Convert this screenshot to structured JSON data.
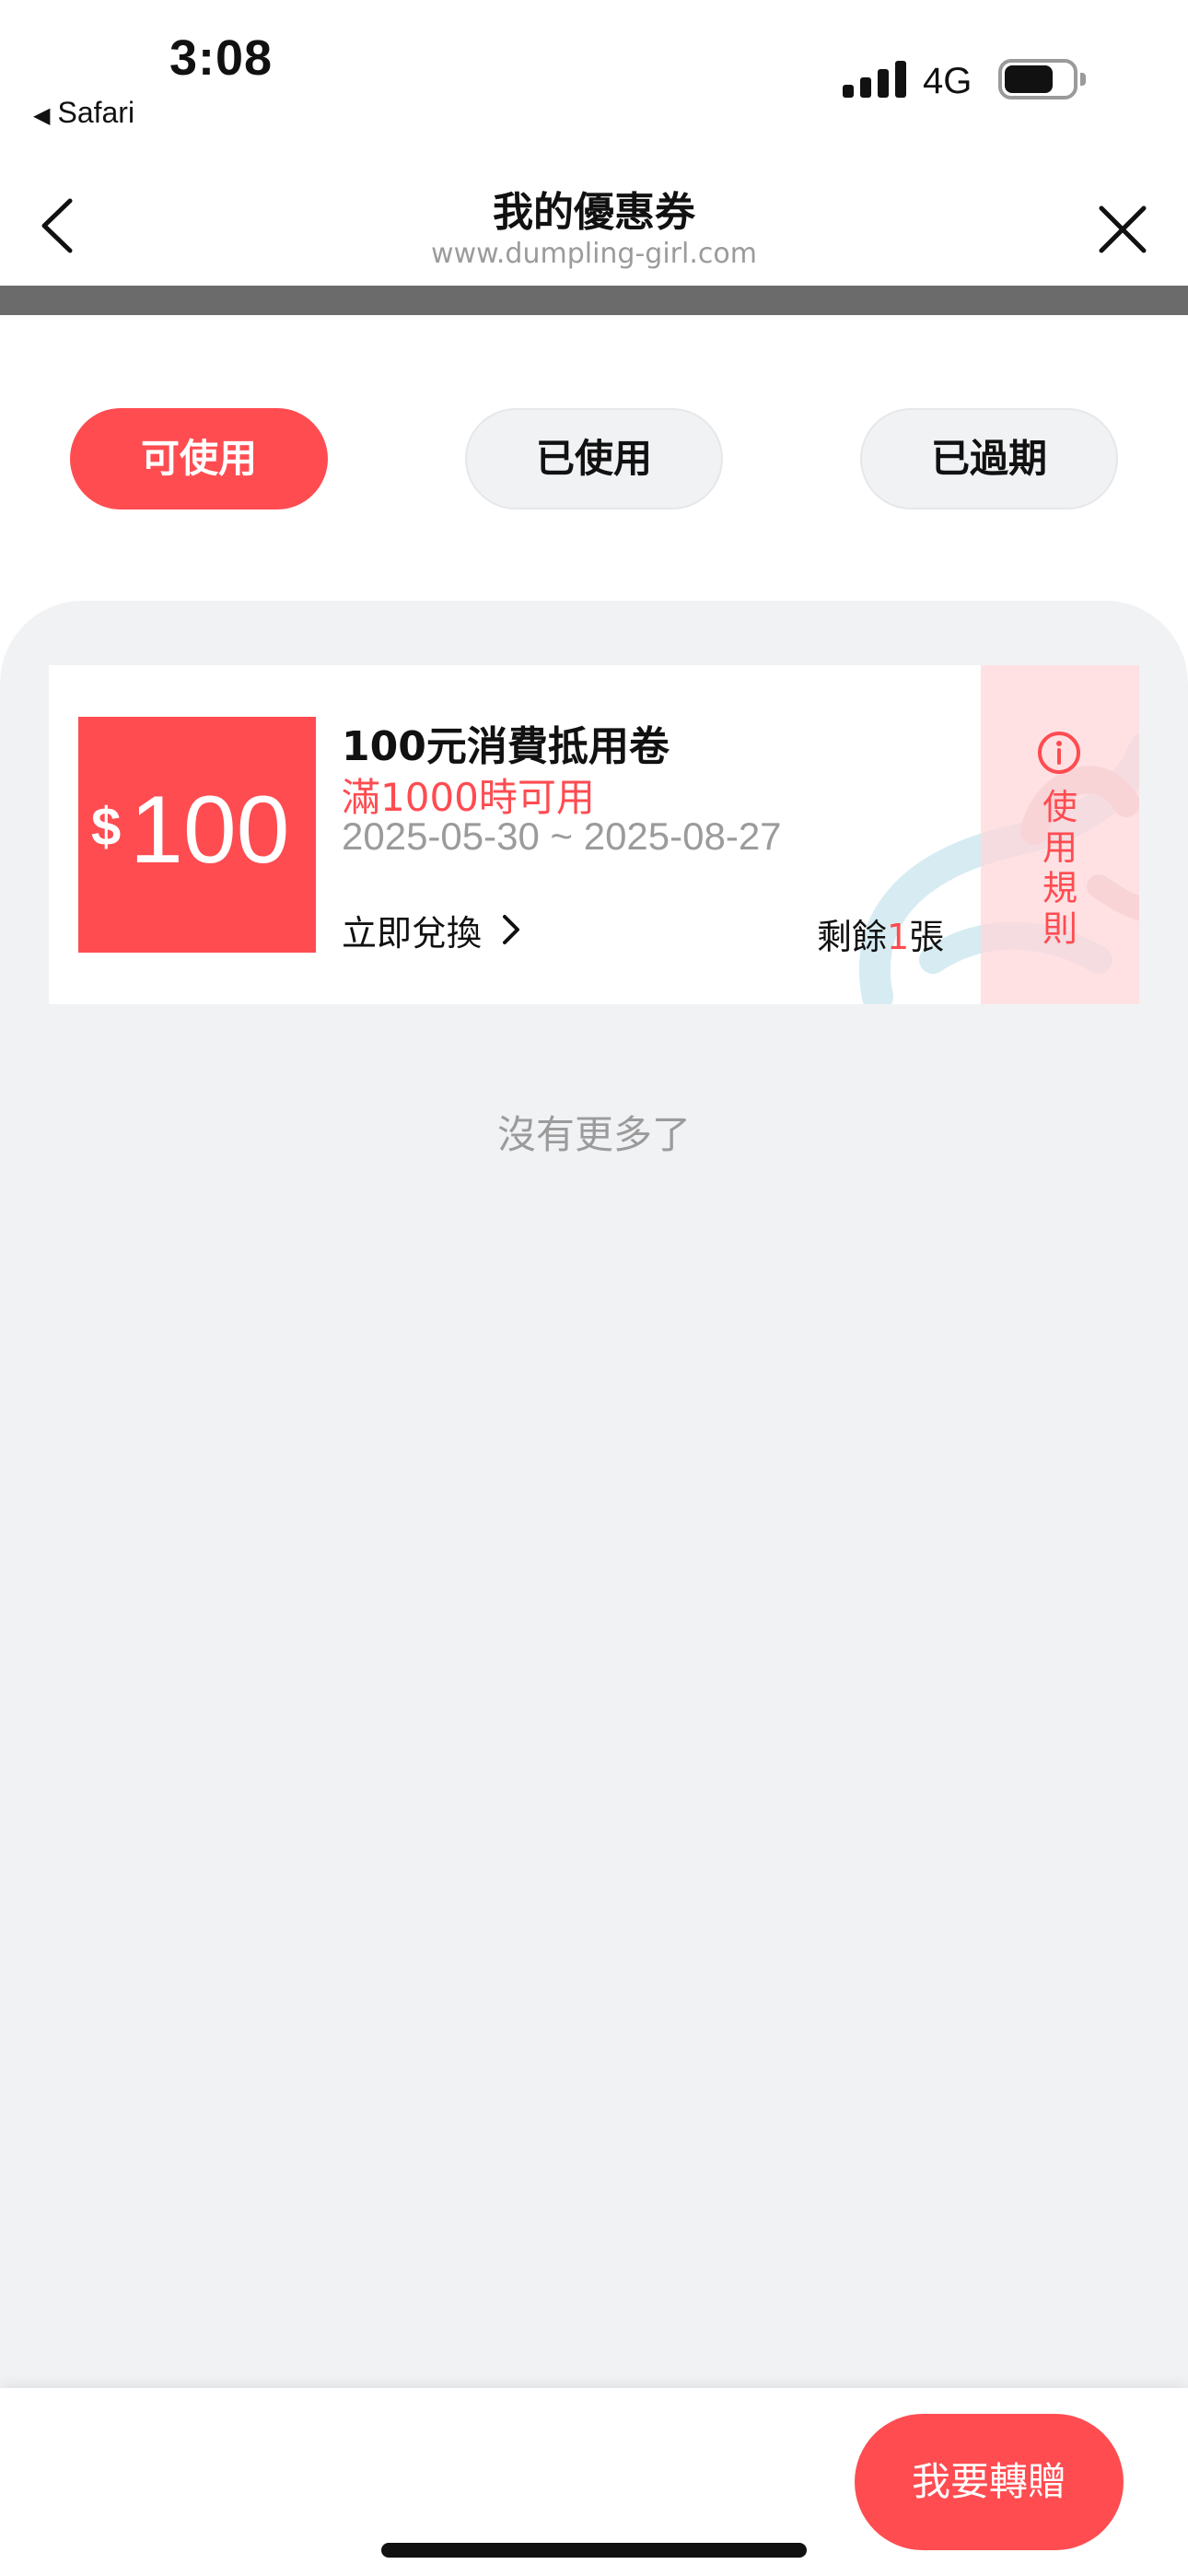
{
  "status_bar": {
    "time": "3:08",
    "back_app": "Safari",
    "network": "4G",
    "icons": [
      "signal-icon",
      "battery-icon"
    ]
  },
  "header": {
    "title": "我的優惠券",
    "url": "www.dumpling-girl.com",
    "icons": [
      "back-arrow-icon",
      "close-icon"
    ]
  },
  "tabs": [
    {
      "label": "可使用",
      "active": true
    },
    {
      "label": "已使用",
      "active": false
    },
    {
      "label": "已過期",
      "active": false
    }
  ],
  "coupons": [
    {
      "currency": "$",
      "amount": "100",
      "title": "100元消費抵用卷",
      "condition": "滿1000時可用",
      "date_range": "2025-05-30 ~ 2025-08-27",
      "redeem_label": "立即兌換",
      "remain_prefix": "剩餘",
      "remain_count": "1",
      "remain_suffix": "張",
      "rules_label": "使用規則"
    }
  ],
  "list_end_text": "沒有更多了",
  "bottom": {
    "transfer_label": "我要轉贈"
  },
  "colors": {
    "accent": "#fe4c51",
    "panel_bg": "#f1f2f4",
    "muted_text": "#9b9b9b"
  }
}
